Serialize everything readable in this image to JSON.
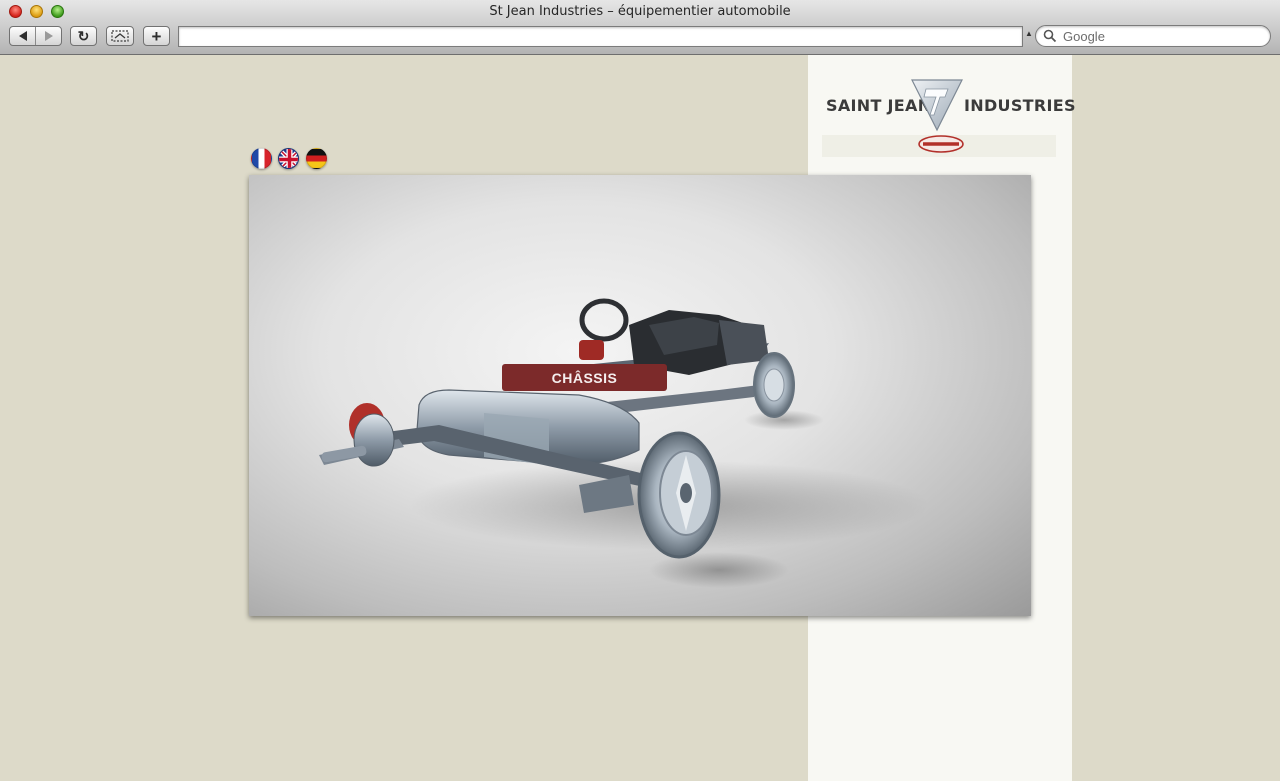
{
  "window": {
    "title": "St Jean Industries – équipementier automobile",
    "address": "",
    "search_placeholder": "Google"
  },
  "toolbar": {
    "back_icon": "back-arrow-icon",
    "forward_icon": "forward-arrow-icon",
    "reload_glyph": "↻",
    "add_glyph": "+"
  },
  "brand": {
    "left_word": "SAINT JEAN",
    "right_word": "INDUSTRIES",
    "sub_brand": "COBAPRESS",
    "accent_color": "#7c2a2a",
    "panel_color": "#f8f8f3",
    "background_color": "#dddac9"
  },
  "languages": [
    {
      "code": "fr",
      "icon": "french-flag-icon"
    },
    {
      "code": "en",
      "icon": "uk-flag-icon"
    },
    {
      "code": "de",
      "icon": "german-flag-icon"
    }
  ],
  "hero": {
    "button_label": "CHÂSSIS",
    "image": "car-chassis-render"
  }
}
